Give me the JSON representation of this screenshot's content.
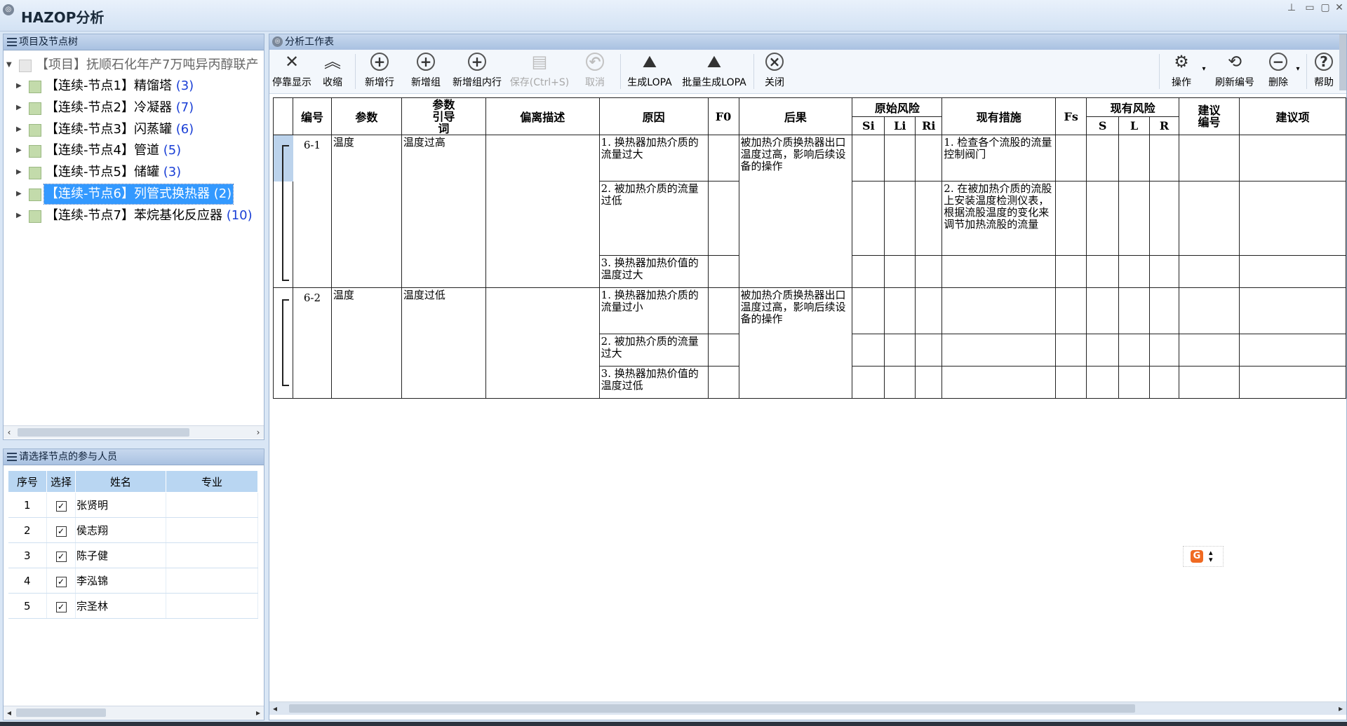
{
  "window": {
    "title": "HAZOP分析",
    "controls": [
      "pin",
      "minimize",
      "maximize",
      "close"
    ]
  },
  "tree_panel": {
    "title": "项目及节点树",
    "project": "【项目】抚顺石化年产7万吨异丙醇联产",
    "nodes": [
      {
        "label": "【连续-节点1】精馏塔",
        "count": "(3)"
      },
      {
        "label": "【连续-节点2】冷凝器",
        "count": "(7)"
      },
      {
        "label": "【连续-节点3】闪蒸罐",
        "count": "(6)"
      },
      {
        "label": "【连续-节点4】管道",
        "count": "(5)"
      },
      {
        "label": "【连续-节点5】储罐",
        "count": "(3)"
      },
      {
        "label": "【连续-节点6】列管式换热器",
        "count": "(2)",
        "selected": true
      },
      {
        "label": "【连续-节点7】苯烷基化反应器",
        "count": "(10)"
      }
    ]
  },
  "participants_panel": {
    "title": "请选择节点的参与人员",
    "columns": [
      "序号",
      "选择",
      "姓名",
      "专业"
    ],
    "rows": [
      {
        "no": "1",
        "checked": "✓",
        "name": "张贤明",
        "major": ""
      },
      {
        "no": "2",
        "checked": "✓",
        "name": "侯志翔",
        "major": ""
      },
      {
        "no": "3",
        "checked": "✓",
        "name": "陈子健",
        "major": ""
      },
      {
        "no": "4",
        "checked": "✓",
        "name": "李泓锦",
        "major": ""
      },
      {
        "no": "5",
        "checked": "✓",
        "name": "宗圣林",
        "major": ""
      }
    ]
  },
  "worksheet_panel": {
    "title": "分析工作表",
    "toolbar": {
      "dock": "停靠显示",
      "collapse": "收缩",
      "add_row": "新增行",
      "add_group": "新增组",
      "add_group_row": "新增组内行",
      "save": "保存(Ctrl+S)",
      "cancel": "取消",
      "gen_lopa": "生成LOPA",
      "batch_lopa": "批量生成LOPA",
      "close": "关闭",
      "operate": "操作",
      "renumber": "刷新编号",
      "delete": "删除",
      "help": "帮助"
    },
    "headers": {
      "no": "编号",
      "param": "参数",
      "guideword": "参数引导词",
      "deviation": "偏离描述",
      "cause": "原因",
      "f0": "F0",
      "consequence": "后果",
      "orig_risk": "原始风险",
      "si": "Si",
      "li": "Li",
      "ri": "Ri",
      "measures": "现有措施",
      "fs": "Fs",
      "cur_risk": "现有风险",
      "s": "S",
      "l": "L",
      "r": "R",
      "sugg_no": "建议编号",
      "sugg": "建议项"
    },
    "groups": [
      {
        "no": "6-1",
        "param": "温度",
        "guideword": "温度过高",
        "consequence": "被加热介质换热器出口温度过高，影响后续设备的操作",
        "causes": [
          "1. 换热器加热介质的流量过大",
          "2. 被加热介质的流量过低",
          "3. 换热器加热价值的温度过大"
        ],
        "measures": [
          "1. 检查各个流股的流量控制阀门",
          "2. 在被加热介质的流股上安装温度检测仪表，根据流股温度的变化来调节加热流股的流量",
          ""
        ]
      },
      {
        "no": "6-2",
        "param": "温度",
        "guideword": "温度过低",
        "consequence": "被加热介质换热器出口温度过高，影响后续设备的操作",
        "causes": [
          "1. 换热器加热介质的流量过小",
          "2. 被加热介质的流量过大",
          "3. 换热器加热价值的温度过低"
        ],
        "measures": [
          "",
          "",
          ""
        ]
      }
    ]
  }
}
